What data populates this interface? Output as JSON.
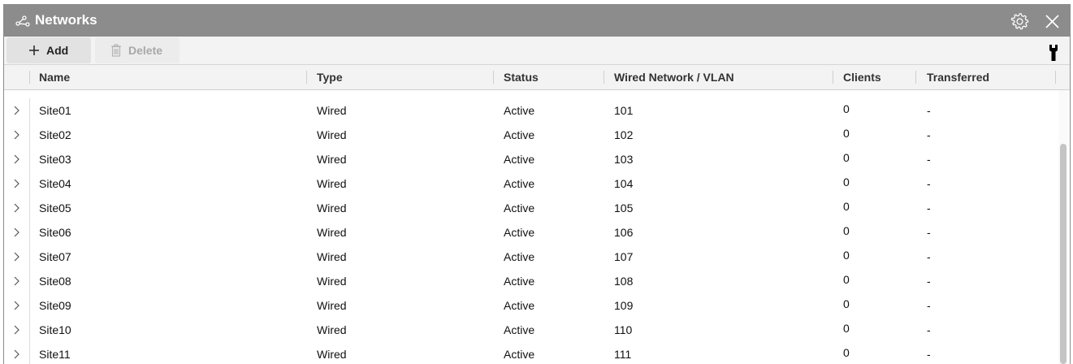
{
  "window": {
    "title": "Networks"
  },
  "toolbar": {
    "add_label": "Add",
    "delete_label": "Delete"
  },
  "table": {
    "columns": [
      "Name",
      "Type",
      "Status",
      "Wired Network / VLAN",
      "Clients",
      "Transferred"
    ],
    "rows": [
      {
        "name": "Site01",
        "type": "Wired",
        "status": "Active",
        "vlan": "101",
        "clients": "0",
        "transferred": "-"
      },
      {
        "name": "Site02",
        "type": "Wired",
        "status": "Active",
        "vlan": "102",
        "clients": "0",
        "transferred": "-"
      },
      {
        "name": "Site03",
        "type": "Wired",
        "status": "Active",
        "vlan": "103",
        "clients": "0",
        "transferred": "-"
      },
      {
        "name": "Site04",
        "type": "Wired",
        "status": "Active",
        "vlan": "104",
        "clients": "0",
        "transferred": "-"
      },
      {
        "name": "Site05",
        "type": "Wired",
        "status": "Active",
        "vlan": "105",
        "clients": "0",
        "transferred": "-"
      },
      {
        "name": "Site06",
        "type": "Wired",
        "status": "Active",
        "vlan": "106",
        "clients": "0",
        "transferred": "-"
      },
      {
        "name": "Site07",
        "type": "Wired",
        "status": "Active",
        "vlan": "107",
        "clients": "0",
        "transferred": "-"
      },
      {
        "name": "Site08",
        "type": "Wired",
        "status": "Active",
        "vlan": "108",
        "clients": "0",
        "transferred": "-"
      },
      {
        "name": "Site09",
        "type": "Wired",
        "status": "Active",
        "vlan": "109",
        "clients": "0",
        "transferred": "-"
      },
      {
        "name": "Site10",
        "type": "Wired",
        "status": "Active",
        "vlan": "110",
        "clients": "0",
        "transferred": "-"
      },
      {
        "name": "Site11",
        "type": "Wired",
        "status": "Active",
        "vlan": "111",
        "clients": "0",
        "transferred": "-"
      }
    ]
  },
  "icons": {
    "title": "network-icon",
    "settings": "gear-icon",
    "close": "close-icon",
    "add": "plus-icon",
    "delete": "trash-icon",
    "tools": "wrench-icon",
    "expand": "chevron-right-icon"
  },
  "colors": {
    "titlebar": "#8c8c8c",
    "toolbar": "#f3f3f3",
    "disabled_text": "#a8a8a8"
  }
}
